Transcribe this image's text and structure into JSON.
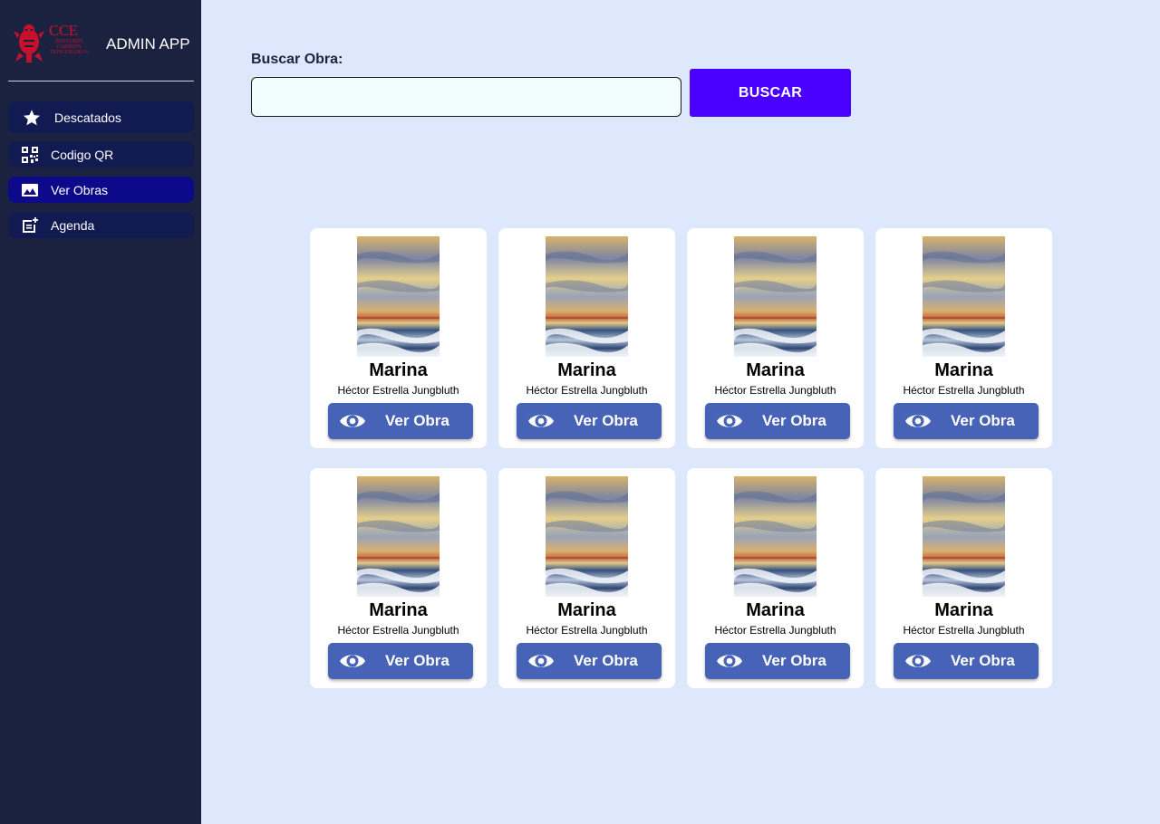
{
  "sidebar": {
    "logo_letters": "CCE",
    "logo_subtext": "BENJAMÍN CARRIÓN TUNGURAHUA",
    "app_title": "ADMIN APP",
    "items": [
      {
        "label": "Descatados",
        "icon": "star-icon"
      },
      {
        "label": "Codigo QR",
        "icon": "qr-code-icon"
      },
      {
        "label": "Ver Obras",
        "icon": "image-icon",
        "active": true
      },
      {
        "label": "Agenda",
        "icon": "post-add-icon"
      }
    ]
  },
  "search": {
    "label": "Buscar Obra:",
    "value": "",
    "placeholder": "",
    "button_label": "BUSCAR"
  },
  "artworks": [
    {
      "title": "Marina",
      "author": "Héctor Estrella Jungbluth",
      "button_label": "Ver Obra"
    },
    {
      "title": "Marina",
      "author": "Héctor Estrella Jungbluth",
      "button_label": "Ver Obra"
    },
    {
      "title": "Marina",
      "author": "Héctor Estrella Jungbluth",
      "button_label": "Ver Obra"
    },
    {
      "title": "Marina",
      "author": "Héctor Estrella Jungbluth",
      "button_label": "Ver Obra"
    },
    {
      "title": "Marina",
      "author": "Héctor Estrella Jungbluth",
      "button_label": "Ver Obra"
    },
    {
      "title": "Marina",
      "author": "Héctor Estrella Jungbluth",
      "button_label": "Ver Obra"
    },
    {
      "title": "Marina",
      "author": "Héctor Estrella Jungbluth",
      "button_label": "Ver Obra"
    },
    {
      "title": "Marina",
      "author": "Héctor Estrella Jungbluth",
      "button_label": "Ver Obra"
    }
  ],
  "colors": {
    "sidebar_bg": "#1a223f",
    "nav_item_bg": "#121a52",
    "nav_item_active_bg": "#0c0a8a",
    "page_bg": "#dde8fc",
    "search_button": "#4a00ff",
    "card_button": "#4763b7",
    "logo_red": "#c8102e"
  }
}
